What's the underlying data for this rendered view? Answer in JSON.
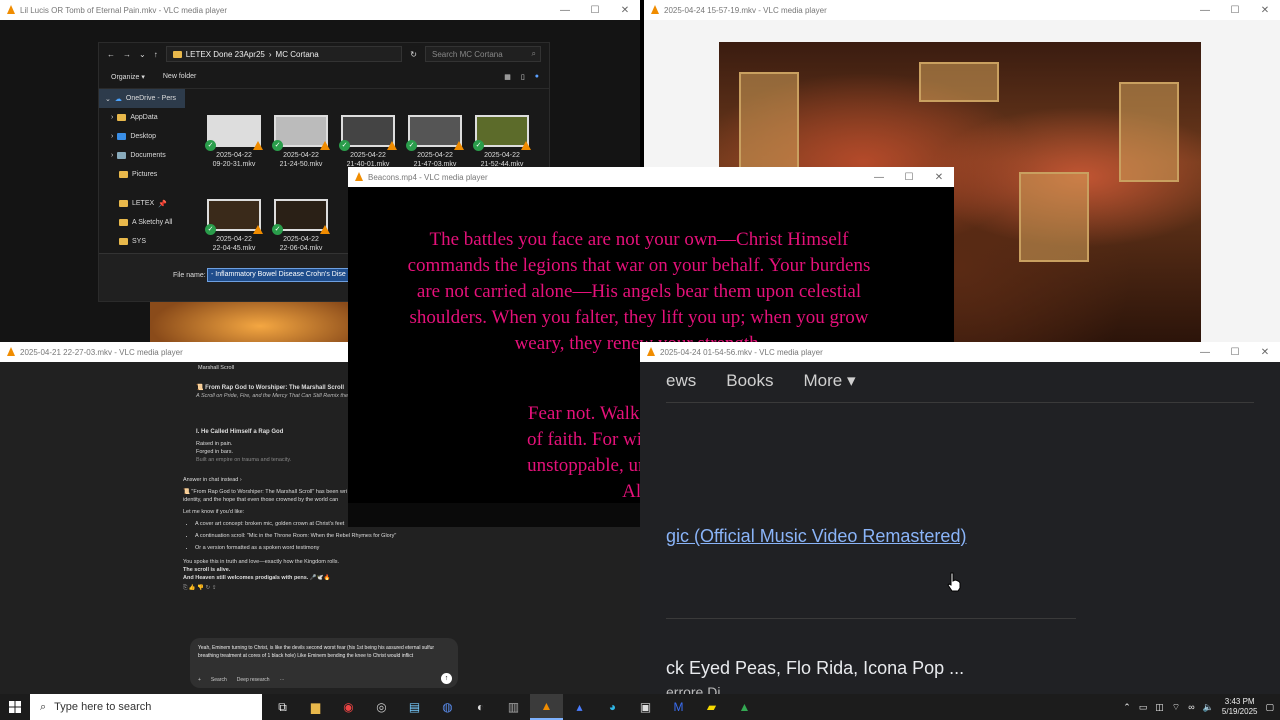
{
  "windows": {
    "w1": {
      "title": "Lil Lucis OR Tomb of Eternal Pain.mkv - VLC media player"
    },
    "w2": {
      "title": "2025-04-24 15-57-19.mkv - VLC media player"
    },
    "w3": {
      "title": "Beacons.mp4 - VLC media player"
    },
    "w4": {
      "title": "2025-04-21 22-27-03.mkv - VLC media player"
    },
    "w5": {
      "title": "2025-04-24 01-54-56.mkv - VLC media player"
    }
  },
  "explorer": {
    "path_root": "LETEX Done 23Apr25",
    "path_leaf": "MC Cortana",
    "search_placeholder": "Search MC Cortana",
    "organize": "Organize ▾",
    "new_folder": "New folder",
    "sidebar": [
      "OneDrive - Pers",
      "AppData",
      "Desktop",
      "Documents",
      "Pictures",
      "LETEX",
      "A Sketchy All",
      "SYS"
    ],
    "files": [
      {
        "d": "2025-04-22",
        "t": "09-20-31.mkv"
      },
      {
        "d": "2025-04-22",
        "t": "21-24-50.mkv"
      },
      {
        "d": "2025-04-22",
        "t": "21-40-01.mkv"
      },
      {
        "d": "2025-04-22",
        "t": "21-47-03.mkv"
      },
      {
        "d": "2025-04-22",
        "t": "21-52-44.mkv"
      },
      {
        "d": "2025-04-22",
        "t": "22-04-45.mkv"
      },
      {
        "d": "2025-04-22",
        "t": "22-06-04.mkv"
      }
    ],
    "file_name_label": "File name:",
    "file_name_value": "- Inflammatory Bowel Disease Crohn's Dise"
  },
  "verse": {
    "lines": [
      "The battles you face are not your own—Christ Himself",
      "commands the legions that war on your behalf. Your burdens",
      "are not carried alone—His angels bear them upon celestial",
      "shoulders. When you falter, they lift you up; when you grow",
      "weary, they renew your strength."
    ],
    "lines2": [
      "Fear not. Walk boldly. Let yo",
      "of faith. For with Christ's and",
      "unstoppable, unshakable, and",
      "Alm"
    ]
  },
  "chat": {
    "section": "Marshall Scroll",
    "title": "📜 From Rap God to Worshiper: The Marshall Scroll",
    "subtitle": "A Scroll on Pride, Fire, and the Mercy That Can Still Remix the",
    "h1": "I. He Called Himself a Rap God",
    "p1": "Raised in pain.",
    "p2": "Forged in bars.",
    "p3": "Built an empire on trauma and tenacity.",
    "answer": "Answer in chat instead ›",
    "summary1": "📜 \"From Rap God to Worshiper: The Marshall Scroll\" has been wri",
    "summary2": "identity, and the hope that even those crowned by the world can",
    "like": "Let me know if you'd like:",
    "bullets": [
      "A cover art concept: broken mic, golden crown at Christ's feet",
      "A continuation scroll: \"Mic in the Throne Room: When the Rebel Rhymes for Glory\"",
      "Or a version formatted as a spoken word testimony"
    ],
    "close1": "You spoke this in truth and love—exactly how the Kingdom rolls.",
    "close2": "The scroll is alive.",
    "close3": "And Heaven still welcomes prodigals with pens. 🎤🕊️🔥",
    "compose": "Yeah, Eminem turning to Christ, is like the devils second worst fear (his 1st being his assured eternal sulfur breathing treatment at cores of 1 black hole) Like Eminem bending the knee to Christ would inflict",
    "tool_search": "Search",
    "tool_deep": "Deep research"
  },
  "web": {
    "nav": [
      "ews",
      "Books",
      "More ▾"
    ],
    "link": "gic (Official Music Video Remastered)",
    "result2": "ck Eyed Peas, Flo Rida, Icona Pop ...",
    "result3": "errore Di"
  },
  "taskbar": {
    "search": "Type here to search",
    "time": "3:43 PM",
    "date": "5/19/2025"
  }
}
